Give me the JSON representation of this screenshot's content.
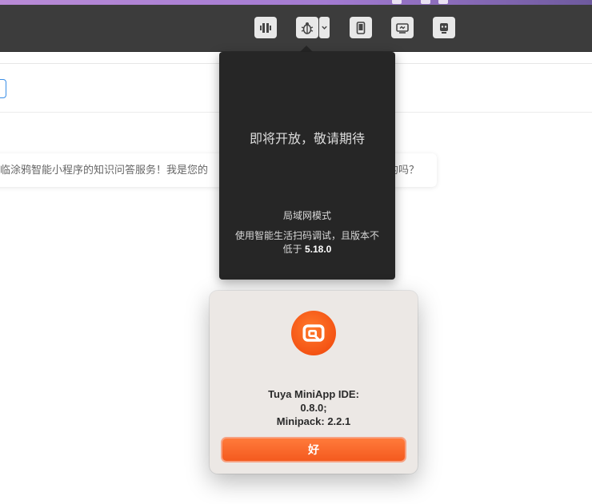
{
  "toolbar": {
    "buttons": [
      {
        "name": "compile-icon"
      },
      {
        "name": "debug-bug-icon"
      },
      {
        "name": "device-icon"
      },
      {
        "name": "remote-icon"
      },
      {
        "name": "robot-icon"
      }
    ]
  },
  "chat": {
    "message_left": "临涂鸦智能小程序的知识问答服务！我是您的",
    "message_right": "的吗？"
  },
  "debug_popover": {
    "title": "即将开放，敬请期待",
    "mode": "局域网模式",
    "desc_prefix": "使用智能生活扫码调试，且版本不低于",
    "version": "5.18.0"
  },
  "about_dialog": {
    "line1": "Tuya MiniApp IDE:",
    "line2": "0.8.0;",
    "line3": "Minipack: 2.2.1",
    "ok_label": "好"
  },
  "colors": {
    "accent": "#f45314",
    "toolbar_bg": "#3c3c3c",
    "popover_bg": "#262626",
    "dialog_bg": "#ece8e5"
  }
}
